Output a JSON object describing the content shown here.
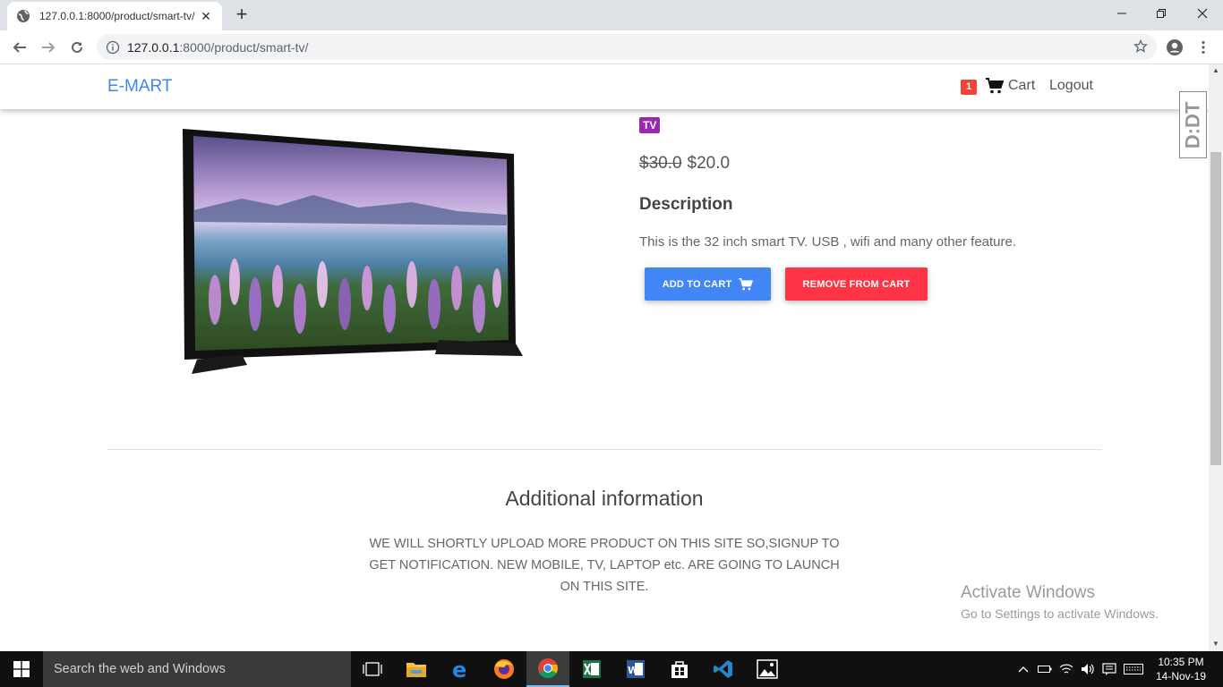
{
  "browser": {
    "tab_title": "127.0.0.1:8000/product/smart-tv/",
    "tab_close": "✕",
    "new_tab": "+",
    "url_host": "127.0.0.1",
    "url_rest": ":8000/product/smart-tv/"
  },
  "navbar": {
    "brand": "E-MART",
    "cart_count": "1",
    "cart_label": "Cart",
    "logout_label": "Logout"
  },
  "product": {
    "category": "TV",
    "old_price": "$30.0",
    "price": "$20.0",
    "description_title": "Description",
    "description": "This is the 32 inch smart TV. USB , wifi and many other feature.",
    "add_to_cart_label": "ADD TO CART",
    "remove_from_cart_label": "REMOVE FROM CART"
  },
  "additional": {
    "title": "Additional information",
    "text": "WE WILL SHORTLY UPLOAD MORE PRODUCT ON THIS SITE SO,SIGNUP TO GET NOTIFICATION. NEW MOBILE, TV, LAPTOP etc. ARE GOING TO LAUNCH ON THIS SITE."
  },
  "extension_badge": "D:DT",
  "watermark": {
    "line1": "Activate Windows",
    "line2": "Go to Settings to activate Windows."
  },
  "taskbar": {
    "search_placeholder": "Search the web and Windows",
    "time": "10:35 PM",
    "date": "14-Nov-19",
    "apps": [
      "task-view",
      "file-explorer",
      "edge",
      "firefox",
      "chrome",
      "excel",
      "word",
      "store",
      "vscode",
      "photos"
    ]
  },
  "colors": {
    "brand": "#4285f4",
    "badge_red": "#f44336",
    "category_purple": "#9c27b0",
    "add_button": "#4285f4",
    "remove_button": "#ff3547"
  }
}
